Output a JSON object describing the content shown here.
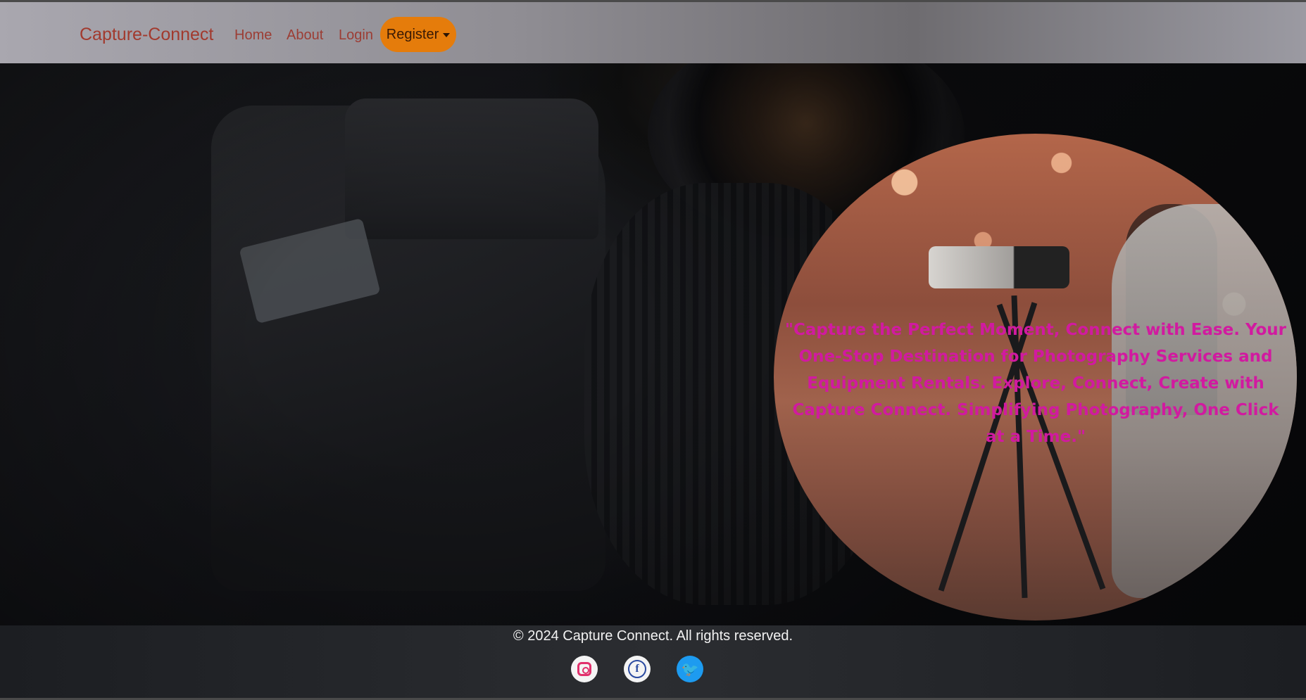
{
  "navbar": {
    "brand": "Capture-Connect",
    "links": [
      "Home",
      "About",
      "Login"
    ],
    "register_label": "Register"
  },
  "hero": {
    "quote": "\"Capture the Perfect Moment, Connect with Ease. Your One-Stop Destination for Photography Services and Equipment Rentals. Explore, Connect, Create with Capture Connect. Simplifying Photography, One Click at a Time.\""
  },
  "footer": {
    "copyright": "© 2024 Capture Connect. All rights reserved.",
    "social": [
      {
        "name": "instagram-icon"
      },
      {
        "name": "facebook-icon"
      },
      {
        "name": "twitter-icon"
      }
    ]
  },
  "colors": {
    "register_bg": "#e57c0b",
    "quote_text": "#d11aa0",
    "nav_link": "#9c3d34"
  }
}
